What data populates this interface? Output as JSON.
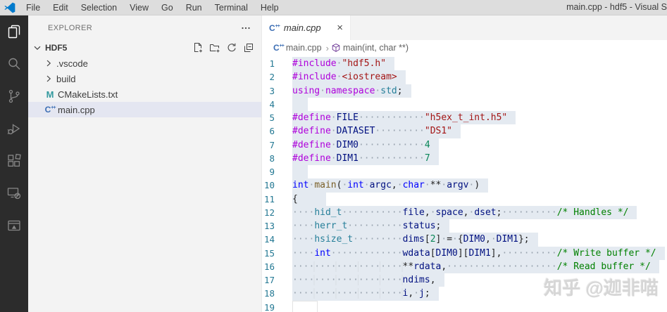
{
  "window": {
    "title": "main.cpp - hdf5 - Visual S"
  },
  "menu_bar": {
    "items": [
      "File",
      "Edit",
      "Selection",
      "View",
      "Go",
      "Run",
      "Terminal",
      "Help"
    ]
  },
  "activity_bar": {
    "items": [
      {
        "name": "explorer-icon",
        "active": true
      },
      {
        "name": "search-icon",
        "active": false
      },
      {
        "name": "source-control-icon",
        "active": false
      },
      {
        "name": "run-debug-icon",
        "active": false
      },
      {
        "name": "extensions-icon",
        "active": false
      },
      {
        "name": "remote-explorer-icon",
        "active": false
      },
      {
        "name": "cmake-panel-icon",
        "active": false
      }
    ]
  },
  "sidebar": {
    "header": {
      "title": "EXPLORER",
      "more_actions_icon": "ellipsis-icon"
    },
    "section": {
      "name": "HDF5",
      "expanded": true,
      "chevron_icon": "chevron-down-icon",
      "actions": [
        "new-file-icon",
        "new-folder-icon",
        "refresh-icon",
        "collapse-all-icon"
      ]
    },
    "tree": [
      {
        "label": ".vscode",
        "icon": "chevron-right-icon",
        "indent": 20,
        "selected": false
      },
      {
        "label": "build",
        "icon": "chevron-right-icon",
        "indent": 20,
        "selected": false
      },
      {
        "label": "CMakeLists.txt",
        "icon": "cmake-icon",
        "indent": 22,
        "selected": false
      },
      {
        "label": "main.cpp",
        "icon": "cpp-icon",
        "indent": 22,
        "selected": true
      }
    ]
  },
  "editor": {
    "tab": {
      "label": "main.cpp",
      "icon": "cpp-icon",
      "preview": true,
      "close_icon": "close-icon"
    },
    "breadcrumb": {
      "items": [
        {
          "label": "main.cpp",
          "icon": "cpp-icon"
        },
        {
          "label": "main(int, char **)",
          "icon": "symbol-method-icon"
        }
      ]
    },
    "code": {
      "language": "cpp",
      "lines": [
        {
          "sel": true,
          "tokens": [
            [
              "pp",
              "#include"
            ],
            [
              "sp",
              1
            ],
            [
              "str",
              "\"hdf5.h\""
            ]
          ]
        },
        {
          "sel": true,
          "tokens": [
            [
              "pp",
              "#include"
            ],
            [
              "sp",
              1
            ],
            [
              "str",
              "<iostream>"
            ]
          ]
        },
        {
          "sel": true,
          "tokens": [
            [
              "pp",
              "using"
            ],
            [
              "sp",
              1
            ],
            [
              "pp",
              "namespace"
            ],
            [
              "sp",
              1
            ],
            [
              "type",
              "std"
            ],
            [
              "pun",
              ";"
            ]
          ]
        },
        {
          "sel": true,
          "tail": 22,
          "tokens": []
        },
        {
          "sel": true,
          "tokens": [
            [
              "pp",
              "#define"
            ],
            [
              "sp",
              1
            ],
            [
              "var",
              "FILE"
            ],
            [
              "sp",
              12
            ],
            [
              "str",
              "\"h5ex_t_int.h5\""
            ]
          ]
        },
        {
          "sel": true,
          "tokens": [
            [
              "pp",
              "#define"
            ],
            [
              "sp",
              1
            ],
            [
              "var",
              "DATASET"
            ],
            [
              "sp",
              9
            ],
            [
              "str",
              "\"DS1\""
            ]
          ]
        },
        {
          "sel": true,
          "tokens": [
            [
              "pp",
              "#define"
            ],
            [
              "sp",
              1
            ],
            [
              "var",
              "DIM0"
            ],
            [
              "sp",
              12
            ],
            [
              "num",
              "4"
            ]
          ]
        },
        {
          "sel": true,
          "tokens": [
            [
              "pp",
              "#define"
            ],
            [
              "sp",
              1
            ],
            [
              "var",
              "DIM1"
            ],
            [
              "sp",
              12
            ],
            [
              "num",
              "7"
            ]
          ]
        },
        {
          "sel": true,
          "tail": 22,
          "tokens": []
        },
        {
          "sel": true,
          "tokens": [
            [
              "kw",
              "int"
            ],
            [
              "sp",
              1
            ],
            [
              "fn",
              "main"
            ],
            [
              "pun",
              "("
            ],
            [
              "sp",
              1
            ],
            [
              "kw",
              "int"
            ],
            [
              "sp",
              1
            ],
            [
              "var",
              "argc"
            ],
            [
              "pun",
              ","
            ],
            [
              "sp",
              1
            ],
            [
              "kw",
              "char"
            ],
            [
              "sp",
              1
            ],
            [
              "pun",
              "**"
            ],
            [
              "sp",
              1
            ],
            [
              "var",
              "argv"
            ],
            [
              "sp",
              1
            ],
            [
              "pun",
              ")"
            ]
          ]
        },
        {
          "sel": true,
          "tail": 40,
          "tokens": [
            [
              "pun",
              "{"
            ]
          ]
        },
        {
          "sel": true,
          "tokens": [
            [
              "sp",
              4
            ],
            [
              "type",
              "hid_t"
            ],
            [
              "sp",
              11
            ],
            [
              "var",
              "file"
            ],
            [
              "pun",
              ","
            ],
            [
              "sp",
              1
            ],
            [
              "var",
              "space"
            ],
            [
              "pun",
              ","
            ],
            [
              "sp",
              1
            ],
            [
              "var",
              "dset"
            ],
            [
              "pun",
              ";"
            ],
            [
              "sp",
              10
            ],
            [
              "com",
              "/* Handles */"
            ]
          ]
        },
        {
          "sel": true,
          "tokens": [
            [
              "sp",
              4
            ],
            [
              "type",
              "herr_t"
            ],
            [
              "sp",
              10
            ],
            [
              "var",
              "status"
            ],
            [
              "pun",
              ";"
            ]
          ]
        },
        {
          "sel": true,
          "tokens": [
            [
              "sp",
              4
            ],
            [
              "type",
              "hsize_t"
            ],
            [
              "sp",
              9
            ],
            [
              "var",
              "dims"
            ],
            [
              "pun",
              "["
            ],
            [
              "num",
              "2"
            ],
            [
              "pun",
              "]"
            ],
            [
              "sp",
              1
            ],
            [
              "pun",
              "="
            ],
            [
              "sp",
              1
            ],
            [
              "pun",
              "{"
            ],
            [
              "var",
              "DIM0"
            ],
            [
              "pun",
              ","
            ],
            [
              "sp",
              1
            ],
            [
              "var",
              "DIM1"
            ],
            [
              "pun",
              "};"
            ]
          ]
        },
        {
          "sel": true,
          "tokens": [
            [
              "sp",
              4
            ],
            [
              "kw",
              "int"
            ],
            [
              "sp",
              13
            ],
            [
              "var",
              "wdata"
            ],
            [
              "pun",
              "["
            ],
            [
              "var",
              "DIM0"
            ],
            [
              "pun",
              "]["
            ],
            [
              "var",
              "DIM1"
            ],
            [
              "pun",
              "],"
            ],
            [
              "sp",
              10
            ],
            [
              "com",
              "/* Write buffer */"
            ]
          ]
        },
        {
          "sel": true,
          "tokens": [
            [
              "sp",
              20,
              "g"
            ],
            [
              "pun",
              "**"
            ],
            [
              "var",
              "rdata"
            ],
            [
              "pun",
              ","
            ],
            [
              "sp",
              20
            ],
            [
              "com",
              "/* Read buffer */"
            ]
          ]
        },
        {
          "sel": true,
          "tokens": [
            [
              "sp",
              20,
              "g"
            ],
            [
              "var",
              "ndims"
            ],
            [
              "pun",
              ","
            ]
          ]
        },
        {
          "sel": true,
          "tokens": [
            [
              "sp",
              20,
              "g"
            ],
            [
              "var",
              "i"
            ],
            [
              "pun",
              ","
            ],
            [
              "sp",
              1
            ],
            [
              "var",
              "j"
            ],
            [
              "pun",
              ";"
            ]
          ]
        },
        {
          "sel": false,
          "cursor": true,
          "tokens": []
        }
      ]
    }
  },
  "watermark": {
    "text": "知乎 @迦非喵"
  },
  "colors": {
    "accent": "#007acc",
    "titlebar_bg": "#dddddd",
    "activity_bar_bg": "#2c2c2c",
    "sidebar_bg": "#f3f3f3",
    "selected_item_bg": "#e4e6f1",
    "selection_bg": "#e4eaf1",
    "line_number": "#237893",
    "token_preprocessor": "#af00db",
    "token_keyword": "#0000ff",
    "token_type": "#267f99",
    "token_function": "#795e26",
    "token_variable": "#001080",
    "token_string": "#a31515",
    "token_number": "#098658",
    "token_comment": "#008000",
    "cpp_icon_color": "#3c6eb4",
    "cmake_icon_color": "#33999e",
    "symbol_method_color": "#652d90",
    "watermark_color": "#d6d6d6"
  }
}
